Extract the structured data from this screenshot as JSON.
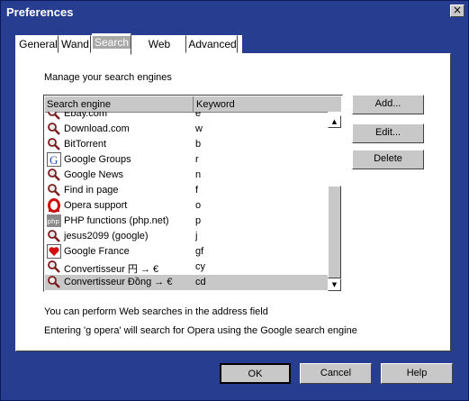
{
  "window": {
    "title": "Preferences",
    "close_glyph": "×"
  },
  "tabs": [
    {
      "label": "General",
      "selected": false
    },
    {
      "label": "Wand",
      "selected": false
    },
    {
      "label": "Search",
      "selected": true
    },
    {
      "label": "Web pages",
      "selected": false
    },
    {
      "label": "Advanced",
      "selected": false
    }
  ],
  "search": {
    "intro": "Manage your search engines",
    "columns": {
      "engine": "Search engine",
      "keyword": "Keyword"
    },
    "engines": [
      {
        "name": "Ebay.com",
        "keyword": "e",
        "icon": "magnifier-icon"
      },
      {
        "name": "Download.com",
        "keyword": "w",
        "icon": "magnifier-icon"
      },
      {
        "name": "BitTorrent",
        "keyword": "b",
        "icon": "magnifier-icon"
      },
      {
        "name": "Google Groups",
        "keyword": "r",
        "icon": "google-g-icon"
      },
      {
        "name": "Google News",
        "keyword": "n",
        "icon": "magnifier-icon"
      },
      {
        "name": "Find in page",
        "keyword": "f",
        "icon": "magnifier-icon"
      },
      {
        "name": "Opera support",
        "keyword": "o",
        "icon": "opera-icon"
      },
      {
        "name": "PHP functions (php.net)",
        "keyword": "p",
        "icon": "php-icon"
      },
      {
        "name": "jesus2099 (google)",
        "keyword": "j",
        "icon": "magnifier-icon"
      },
      {
        "name": "Google France",
        "keyword": "gf",
        "icon": "heart-icon"
      },
      {
        "name": "Convertisseur 円 → €",
        "keyword": "cy",
        "icon": "magnifier-icon"
      },
      {
        "name": "Convertisseur Đồng → €",
        "keyword": "cd",
        "icon": "magnifier-icon",
        "selected": true
      }
    ],
    "buttons": {
      "add": "Add...",
      "edit": "Edit...",
      "delete": "Delete"
    },
    "info_line1": "You can perform Web searches in the address field",
    "info_line2": "Entering 'g opera' will search for Opera using the Google search engine"
  },
  "dialog_buttons": {
    "ok": "OK",
    "cancel": "Cancel",
    "help": "Help"
  }
}
